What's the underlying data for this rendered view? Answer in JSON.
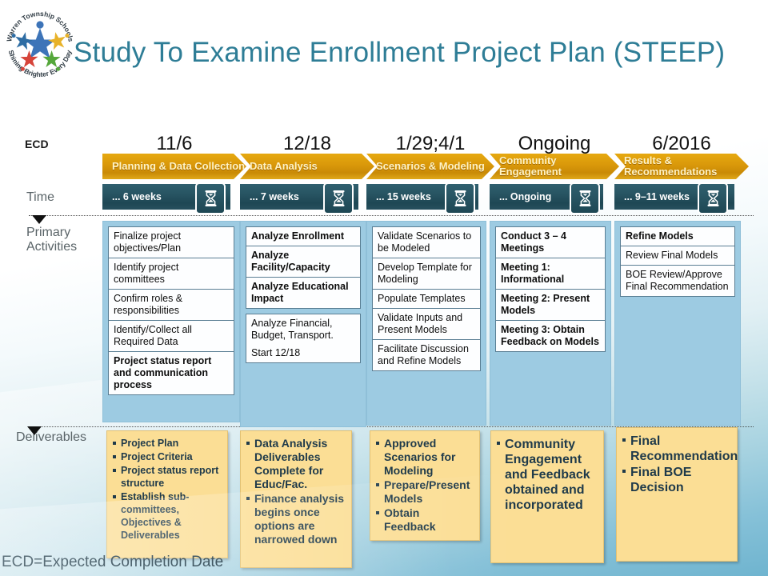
{
  "slide": {
    "title": "Study To Examine Enrollment Project Plan (STEEP)",
    "footnote": "ECD=Expected Completion Date",
    "logo": {
      "top_text": "Warren Township Schools",
      "bottom_text": "Shining Brighter Every Day"
    }
  },
  "rail": {
    "ecd_label": "ECD",
    "time_label": "Time",
    "primary_label": "Primary Activities",
    "deliverables_label": "Deliverables"
  },
  "colors": {
    "title": "#2E7D96",
    "chevron": "#D9980A",
    "chevron_text": "#FFF3C4",
    "timebar": "#265260",
    "activity_panel": "#9DCBE2",
    "deliverable_box": "#FBDE95",
    "deliverable_text": "#1F3A4A",
    "background_bottom": "#6FB4CF"
  },
  "phases": [
    {
      "ecd": "11/6",
      "name": "Planning & Data Collection",
      "duration": "...  6 weeks",
      "icon": "hourglass-icon",
      "activities": [
        {
          "text": "Finalize project objectives/Plan",
          "bold": false
        },
        {
          "text": "Identify project committees",
          "bold": false
        },
        {
          "text": "Confirm roles & responsibilities",
          "bold": false
        },
        {
          "text": "Identify/Collect all Required Data",
          "bold": false
        },
        {
          "text": "Project status report and communication process",
          "bold": true
        }
      ],
      "deliverables": [
        "Project Plan",
        "Project Criteria",
        "Project status report structure",
        "Establish sub-committees, Objectives & Deliverables"
      ]
    },
    {
      "ecd": "12/18",
      "name": "Data Analysis",
      "duration": "...  7 weeks",
      "icon": "hourglass-icon",
      "activities": [
        {
          "text": "Analyze Enrollment",
          "bold": true
        },
        {
          "text": "Analyze Facility/Capacity",
          "bold": true
        },
        {
          "text": "Analyze Educational Impact",
          "bold": true
        },
        {
          "text": "Analyze Financial, Budget, Transport.",
          "bold": false,
          "sub": "Start 12/18"
        }
      ],
      "deliverables": [
        "Data Analysis Deliverables Complete for Educ/Fac.",
        "Finance analysis begins once options are narrowed down"
      ]
    },
    {
      "ecd": "1/29;4/1",
      "name": "Scenarios & Modeling",
      "duration": "...  15 weeks",
      "icon": "hourglass-icon",
      "activities": [
        {
          "text": "Validate Scenarios to be Modeled",
          "bold": false
        },
        {
          "text": "Develop Template for Modeling",
          "bold": false
        },
        {
          "text": "Populate Templates",
          "bold": false
        },
        {
          "text": "Validate Inputs and Present Models",
          "bold": false
        },
        {
          "text": "Facilitate Discussion and Refine Models",
          "bold": false
        }
      ],
      "deliverables": [
        "Approved Scenarios for Modeling",
        "Prepare/Present Models",
        "Obtain Feedback"
      ]
    },
    {
      "ecd": "Ongoing",
      "name": "Community Engagement",
      "duration": "...  Ongoing",
      "icon": "hourglass-icon",
      "activities": [
        {
          "text": "Conduct 3 – 4 Meetings",
          "bold": true
        },
        {
          "text": "Meeting 1: Informational",
          "bold": true
        },
        {
          "text": "Meeting 2: Present Models",
          "bold": true
        },
        {
          "text": "Meeting 3: Obtain Feedback on Models",
          "bold": true
        }
      ],
      "deliverables": [
        "Community Engagement and Feedback obtained and incorporated"
      ]
    },
    {
      "ecd": "6/2016",
      "name": "Results & Recommendations",
      "duration": "...  9–11 weeks",
      "icon": "hourglass-icon",
      "activities": [
        {
          "text": "Refine Models",
          "bold": true
        },
        {
          "text": "Review Final Models",
          "bold": false
        },
        {
          "text": "BOE Review/Approve Final Recommendation",
          "bold": false
        }
      ],
      "deliverables": [
        "Final Recommendation",
        "Final BOE Decision"
      ]
    }
  ]
}
